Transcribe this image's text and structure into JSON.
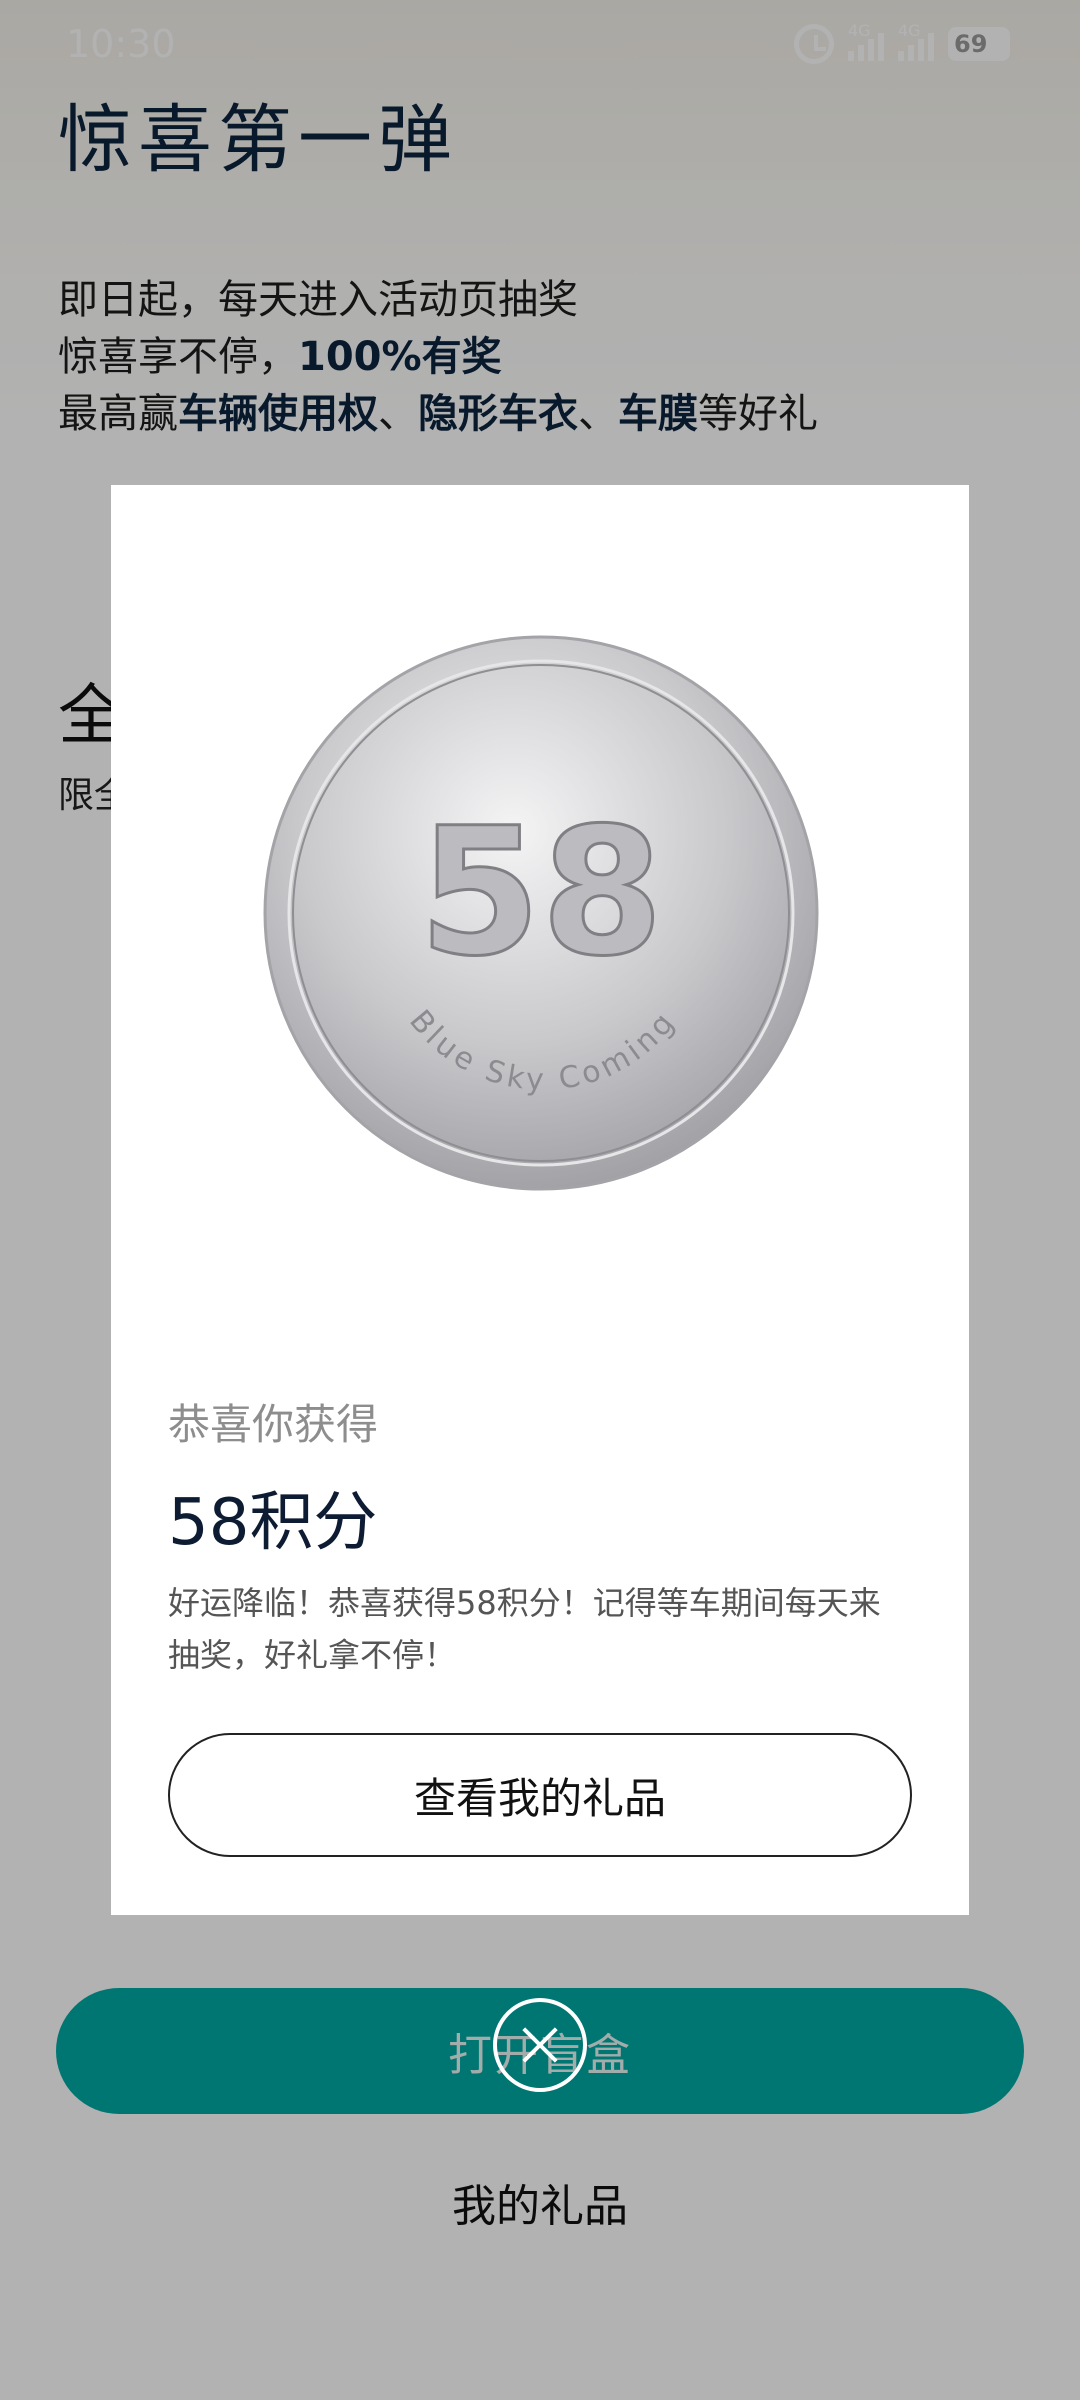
{
  "status_bar": {
    "time": "10:30",
    "signal1_label": "4G",
    "signal2_label": "4G",
    "battery": "69",
    "icons": [
      "alarm-icon",
      "signal-icon",
      "signal-icon",
      "battery-icon"
    ]
  },
  "page": {
    "title": "惊喜第一弹",
    "intro_line1": "即日起，每天进入活动页抽奖",
    "intro_line2_prefix": "惊喜享不停，",
    "intro_line2_bold": "100%有奖",
    "intro_line3_prefix": "最高赢",
    "intro_line3_bold1": "车辆使用权",
    "intro_line3_sep1": "、",
    "intro_line3_bold2": "隐形车衣",
    "intro_line3_sep2": "、",
    "intro_line3_bold3": "车膜",
    "intro_line3_suffix": "等好礼",
    "section_heading_partial": "全",
    "section_sub_partial": "限全",
    "open_button_label": "打开盲盒",
    "my_gifts_link": "我的礼品"
  },
  "modal": {
    "coin_number": "58",
    "coin_text": "Blue Sky Coming",
    "congrats": "恭喜你获得",
    "prize": "58积分",
    "description": "好运降临！恭喜获得58积分！记得等车期间每天来抽奖，好礼拿不停！",
    "button_label": "查看我的礼品",
    "close_icon": "close-icon"
  },
  "colors": {
    "accent_teal": "#00aaa4",
    "title_navy": "#0d2540",
    "overlay": "rgba(0,0,0,0.30)"
  }
}
